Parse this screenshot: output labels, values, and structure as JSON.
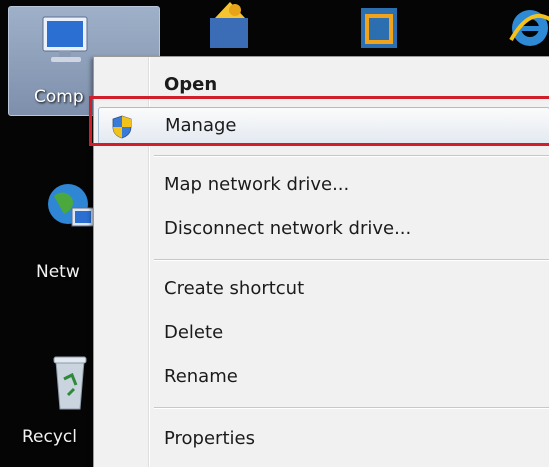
{
  "desktop": {
    "icons": [
      {
        "label": "Comp",
        "icon": "computer-icon"
      },
      {
        "label": "Netw",
        "icon": "network-icon"
      },
      {
        "label": "Recycl",
        "icon": "recycle-bin-icon"
      }
    ],
    "top_icons": [
      "program-icon",
      "window-icon",
      "internet-explorer-icon"
    ]
  },
  "context_menu": {
    "items": [
      {
        "label": "Open",
        "bold": true
      },
      {
        "label": "Manage",
        "icon": "uac-shield-icon",
        "highlighted": true
      },
      {
        "label": "Map network drive..."
      },
      {
        "label": "Disconnect network drive..."
      },
      {
        "label": "Create shortcut"
      },
      {
        "label": "Delete"
      },
      {
        "label": "Rename"
      },
      {
        "label": "Properties"
      }
    ]
  },
  "colors": {
    "highlight_box": "#d01f2a",
    "menu_bg": "#f1f1f1",
    "desktop_bg": "#050505"
  }
}
